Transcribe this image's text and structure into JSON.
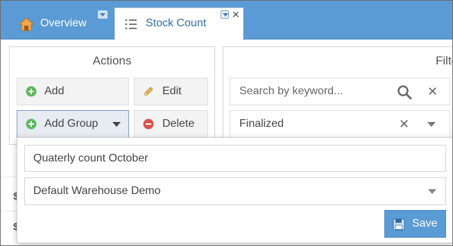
{
  "tabs": [
    {
      "label": "Overview",
      "icon": "home-icon"
    },
    {
      "label": "Stock Count",
      "icon": "list-icon",
      "active": true
    }
  ],
  "actions": {
    "title": "Actions",
    "add": "Add",
    "edit": "Edit",
    "add_group": "Add Group",
    "delete": "Delete"
  },
  "filter": {
    "title": "Filte",
    "search_placeholder": "Search by keyword...",
    "status_value": "Finalized"
  },
  "popup": {
    "name_value": "Quaterly count October",
    "warehouse_value": "Default Warehouse Demo",
    "save_label": "Save"
  },
  "colors": {
    "accent": "#5b9bd5",
    "add_icon": "#5cb85c",
    "delete_icon": "#d9534f",
    "edit_icon": "#e8b84a"
  }
}
